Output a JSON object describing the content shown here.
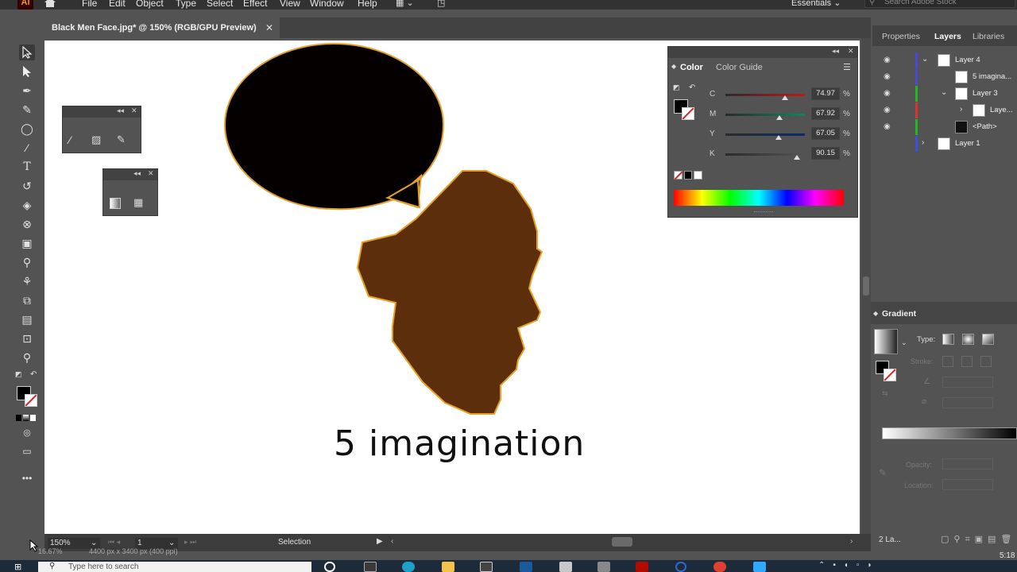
{
  "app": {
    "logo_text": "Ai",
    "menu": [
      "File",
      "Edit",
      "Object",
      "Type",
      "Select",
      "Effect",
      "View",
      "Window",
      "Help"
    ],
    "workspace": "Essentials",
    "search_placeholder": "Search Adobe Stock"
  },
  "document": {
    "tab_title": "Black Men Face.jpg* @ 150% (RGB/GPU Preview)",
    "close_glyph": "✕"
  },
  "canvas": {
    "caption": "5 imagination",
    "bubble_fill": "#050000",
    "bubble_stroke": "#e0a030",
    "face_fill": "#5c2e0c",
    "face_stroke": "#e8a020"
  },
  "color_panel": {
    "tabs": [
      "Color",
      "Color Guide"
    ],
    "sliders": [
      {
        "label": "C",
        "value": "74.97",
        "fraction": 0.7497,
        "color": "#c01818"
      },
      {
        "label": "M",
        "value": "67.92",
        "fraction": 0.6792,
        "color": "#0a8a5a"
      },
      {
        "label": "Y",
        "value": "67.05",
        "fraction": 0.6705,
        "color": "#0a2a6a"
      },
      {
        "label": "K",
        "value": "90.15",
        "fraction": 0.9015,
        "color": "#555555"
      }
    ],
    "percent": "%"
  },
  "right_panel": {
    "tabs": [
      "Properties",
      "Layers",
      "Libraries"
    ],
    "layers": [
      {
        "name": "Layer 4",
        "color": "#4a4ad0",
        "chev": "⌄"
      },
      {
        "name": "5 imagina...",
        "color": "#4a4ad0",
        "chev": ""
      },
      {
        "name": "Layer 3",
        "color": "#22b822",
        "chev": "⌄"
      },
      {
        "name": "Laye...",
        "color": "#e03030",
        "chev": "›"
      },
      {
        "name": "<Path>",
        "color": "#22b822",
        "chev": ""
      },
      {
        "name": "Layer 1",
        "color": "#3a50e0",
        "chev": "›"
      }
    ],
    "layer_count": "2 La..."
  },
  "gradient_panel": {
    "title": "Gradient",
    "type_label": "Type:",
    "stroke_label": "Stroke:",
    "opacity_label": "Opacity:",
    "location_label": "Location:"
  },
  "status": {
    "zoom": "150%",
    "page": "1",
    "mode": "Selection",
    "sub_left": "16.67%",
    "sub_mid": "4400 px x 3400 px (400 ppi)"
  },
  "taskbar": {
    "search_placeholder": "Type here to search",
    "clock": "5:18"
  }
}
